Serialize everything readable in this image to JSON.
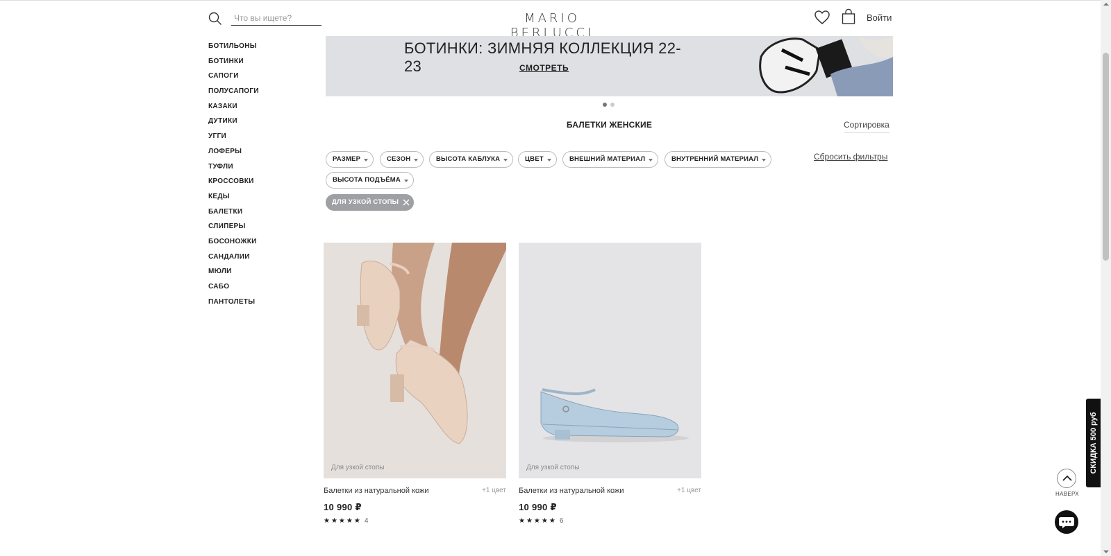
{
  "header": {
    "search_placeholder": "Что вы ищете?",
    "logo": "MARIO BERLUCCI",
    "login_label": "Войти"
  },
  "sidebar": {
    "items": [
      {
        "label": "БОТИЛЬОНЫ"
      },
      {
        "label": "БОТИНКИ"
      },
      {
        "label": "САПОГИ"
      },
      {
        "label": "ПОЛУСАПОГИ"
      },
      {
        "label": "КАЗАКИ"
      },
      {
        "label": "ДУТИКИ"
      },
      {
        "label": "УГГИ"
      },
      {
        "label": "ЛОФЕРЫ"
      },
      {
        "label": "ТУФЛИ"
      },
      {
        "label": "КРОССОВКИ"
      },
      {
        "label": "КЕДЫ"
      },
      {
        "label": "БАЛЕТКИ"
      },
      {
        "label": "СЛИПЕРЫ"
      },
      {
        "label": "БОСОНОЖКИ"
      },
      {
        "label": "САНДАЛИИ"
      },
      {
        "label": "МЮЛИ"
      },
      {
        "label": "САБО"
      },
      {
        "label": "ПАНТОЛЕТЫ"
      }
    ]
  },
  "banner": {
    "title": "БОТИНКИ: ЗИМНЯЯ КОЛЛЕКЦИЯ 22-23",
    "link_label": "СМОТРЕТЬ",
    "slide_count": 2,
    "active_slide": 1
  },
  "listing": {
    "title": "БАЛЕТКИ ЖЕНСКИЕ",
    "sort_label": "Сортировка",
    "reset_label": "Сбросить фильтры"
  },
  "filters": [
    {
      "label": "РАЗМЕР"
    },
    {
      "label": "СЕЗОН"
    },
    {
      "label": "ВЫСОТА КАБЛУКА"
    },
    {
      "label": "ЦВЕТ"
    },
    {
      "label": "ВНЕШНИЙ МАТЕРИАЛ"
    },
    {
      "label": "ВНУТРЕННИЙ МАТЕРИАЛ"
    },
    {
      "label": "ВЫСОТА ПОДЪЁМА"
    }
  ],
  "active_filter": {
    "label": "ДЛЯ УЗКОЙ СТОПЫ"
  },
  "products": [
    {
      "tag": "Для узкой стопы",
      "name": "Балетки из натуральной кожи",
      "colors": "+1 цвет",
      "price": "10 990 ₽",
      "stars": "★★★★★",
      "reviews": "4",
      "color": "#e3cbb8"
    },
    {
      "tag": "Для узкой стопы",
      "name": "Балетки из натуральной кожи",
      "colors": "+1 цвет",
      "price": "10 990 ₽",
      "stars": "★★★★★",
      "reviews": "6",
      "color": "#b6cde0"
    }
  ],
  "widgets": {
    "discount_label": "СКИДКА 500 руб",
    "up_label": "НАВЕРХ"
  }
}
